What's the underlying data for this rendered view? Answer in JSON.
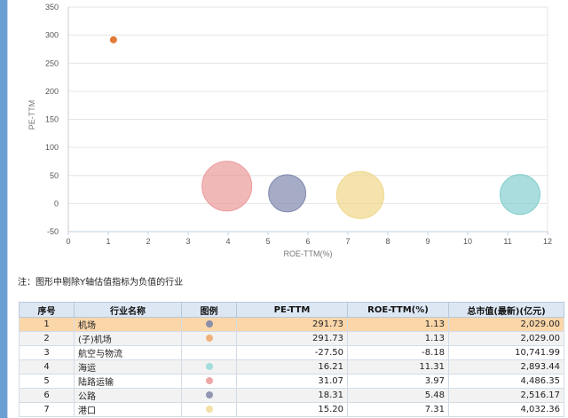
{
  "chart_data": {
    "type": "scatter",
    "xlabel": "ROE-TTM(%)",
    "ylabel": "PE-TTM",
    "xlim": [
      0,
      12
    ],
    "ylim": [
      -50,
      350
    ],
    "x_ticks": [
      0,
      1,
      2,
      3,
      4,
      5,
      6,
      7,
      8,
      9,
      10,
      11,
      12
    ],
    "y_ticks": [
      -50,
      0,
      50,
      100,
      150,
      200,
      250,
      300,
      350
    ],
    "grid": true,
    "points": [
      {
        "x": 1.13,
        "y": 291.73,
        "size": 2029.0,
        "color": "#e07b39"
      },
      {
        "x": 11.31,
        "y": 16.21,
        "size": 2893.44,
        "color": "#86cfcf"
      },
      {
        "x": 3.97,
        "y": 31.07,
        "size": 4486.35,
        "color": "#eb9a9a"
      },
      {
        "x": 5.48,
        "y": 18.31,
        "size": 2516.17,
        "color": "#8089ad"
      },
      {
        "x": 7.31,
        "y": 15.2,
        "size": 4032.36,
        "color": "#efd78a"
      }
    ]
  },
  "note": "注：图形中剔除Y轴估值指标为负值的行业",
  "table": {
    "headers": [
      "序号",
      "行业名称",
      "图例",
      "PE-TTM",
      "ROE-TTM(%)",
      "总市值(最新)(亿元)"
    ],
    "rows": [
      {
        "no": "1",
        "name": "机场",
        "color": "#8a8fa8",
        "pe": "291.73",
        "roe": "1.13",
        "cap": "2,029.00"
      },
      {
        "no": "2",
        "name": "(子)机场",
        "color": "#f0b27a",
        "pe": "291.73",
        "roe": "1.13",
        "cap": "2,029.00"
      },
      {
        "no": "3",
        "name": "航空与物流",
        "color": "",
        "pe": "-27.50",
        "roe": "-8.18",
        "cap": "10,741.99"
      },
      {
        "no": "4",
        "name": "海运",
        "color": "#a4dcdc",
        "pe": "16.21",
        "roe": "11.31",
        "cap": "2,893.44"
      },
      {
        "no": "5",
        "name": "陆路运输",
        "color": "#eda7a7",
        "pe": "31.07",
        "roe": "3.97",
        "cap": "4,486.35"
      },
      {
        "no": "6",
        "name": "公路",
        "color": "#9096b3",
        "pe": "18.31",
        "roe": "5.48",
        "cap": "2,516.17"
      },
      {
        "no": "7",
        "name": "港口",
        "color": "#f2e0a6",
        "pe": "15.20",
        "roe": "7.31",
        "cap": "4,032.36"
      }
    ]
  }
}
